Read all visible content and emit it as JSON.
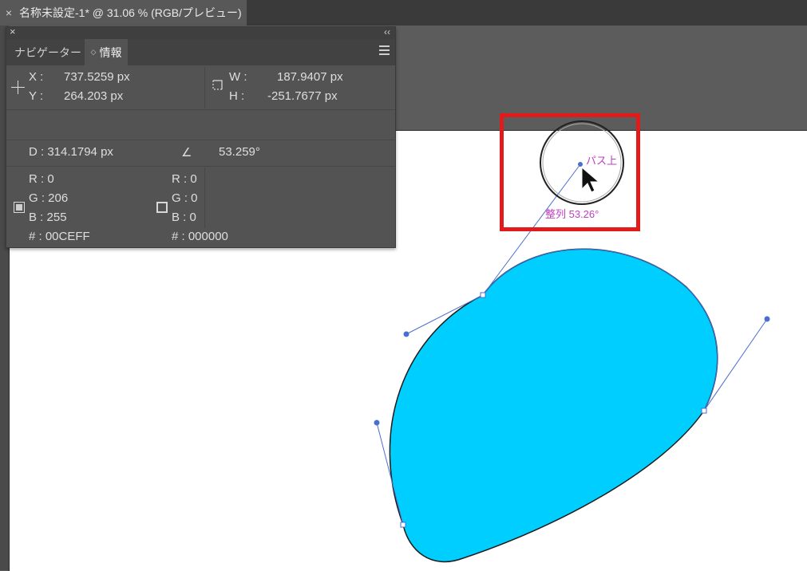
{
  "document_tab": {
    "close_icon": "×",
    "title": "名称未設定-1* @ 31.06 % (RGB/プレビュー)"
  },
  "panel": {
    "close_icon": "×",
    "collapse_icon": "‹‹",
    "tabs": [
      {
        "label": "ナビゲーター",
        "active": false
      },
      {
        "label": "情報",
        "active": true
      }
    ],
    "position": {
      "x_label": "X :",
      "x_value": "737.5259 px",
      "y_label": "Y :",
      "y_value": "264.203 px"
    },
    "size": {
      "w_label": "W :",
      "w_value": "187.9407 px",
      "h_label": "H :",
      "h_value": "-251.7677 px"
    },
    "distance": {
      "d_label": "D : 314.1794 px",
      "angle_icon": "∠",
      "angle_value": "53.259°"
    },
    "fill_color": {
      "r": "R : 0",
      "g": "G : 206",
      "b": "B : 255",
      "hex": "# : 00CEFF"
    },
    "stroke_color": {
      "r": "R : 0",
      "g": "G : 0",
      "b": "B : 0",
      "hex": "# : 000000"
    }
  },
  "canvas": {
    "shape_fill": "#00CEFF",
    "highlight_color": "#e11b1b",
    "smart_guide_color": "#c040c0",
    "path_label": "パス上",
    "angle_label": "整列 53.26°"
  }
}
